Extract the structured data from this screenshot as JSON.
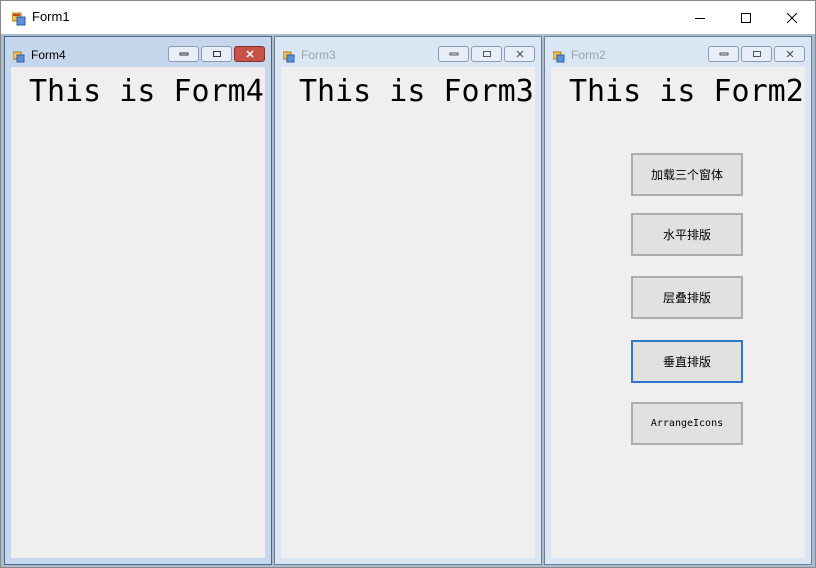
{
  "window": {
    "title": "Form1",
    "icon": "form-app-icon"
  },
  "controls": {
    "minimize": "minimize-icon",
    "maximize": "maximize-icon",
    "close": "close-icon"
  },
  "forms": [
    {
      "title": "Form4",
      "heading": "This is Form4",
      "active": true
    },
    {
      "title": "Form3",
      "heading": "This is Form3",
      "active": false
    },
    {
      "title": "Form2",
      "heading": "This is Form2",
      "active": false
    }
  ],
  "form2_buttons": {
    "load": "加载三个窗体",
    "horizontal": "水平排版",
    "cascade": "层叠排版",
    "vertical": "垂直排版",
    "arrange": "ArrangeIcons"
  },
  "colors": {
    "mdi_background": "#abbccf",
    "client": "#efefef",
    "close_active": "#c75247",
    "focus": "#2f78c9"
  }
}
